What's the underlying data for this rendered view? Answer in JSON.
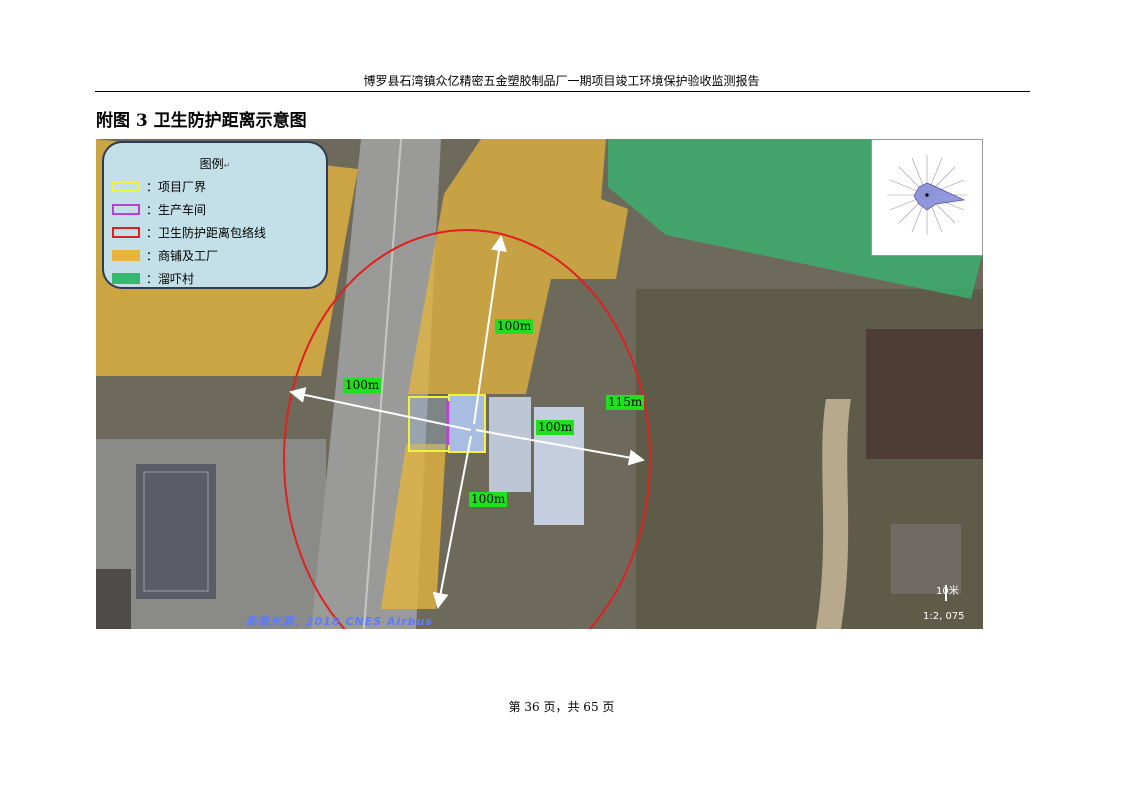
{
  "header": {
    "title": "博罗县石湾镇众亿精密五金塑胶制品厂一期项目竣工环境保护验收监测报告"
  },
  "caption": "附图 3  卫生防护距离示意图",
  "legend": {
    "title": "图例",
    "items": [
      {
        "label": "：项目厂界",
        "color": "#f2f23a"
      },
      {
        "label": "：生产车间",
        "color": "#c23bd6"
      },
      {
        "label": "：卫生防护距离包络线",
        "color": "#e02020"
      },
      {
        "label": "：商铺及工厂",
        "color": "#e5b53c"
      },
      {
        "label": "：溜吓村",
        "color": "#35b870"
      }
    ]
  },
  "distances": {
    "north": "100m",
    "west": "100m",
    "east": "100m",
    "south": "100m",
    "radius": "115m"
  },
  "map": {
    "source": "影像来源：2018 CNES  Airbus",
    "scale_distance": "10米",
    "scale_ratio": "1:2, 075"
  },
  "footer": {
    "page_info": "第 36 页，共 65 页"
  }
}
